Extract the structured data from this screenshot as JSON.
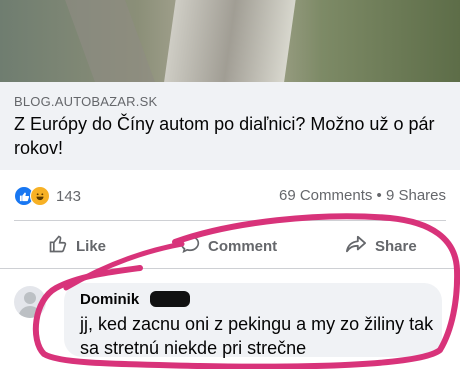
{
  "link_preview": {
    "domain": "BLOG.AUTOBAZAR.SK",
    "headline": "Z Európy do Číny autom po diaľnici? Možno už o pár rokov!"
  },
  "engagement": {
    "reaction_count": "143",
    "stats": "69 Comments • 9 Shares"
  },
  "actions": {
    "like_label": "Like",
    "comment_label": "Comment",
    "share_label": "Share"
  },
  "comment": {
    "author": "Dominik",
    "text": "jj, ked zacnu oni z pekingu a my zo žiliny tak sa stretnú niekde pri strečne"
  },
  "colors": {
    "highlight_circle": "#d8337a",
    "reaction_like": "#1877f2",
    "reaction_haha": "#f7b125"
  }
}
